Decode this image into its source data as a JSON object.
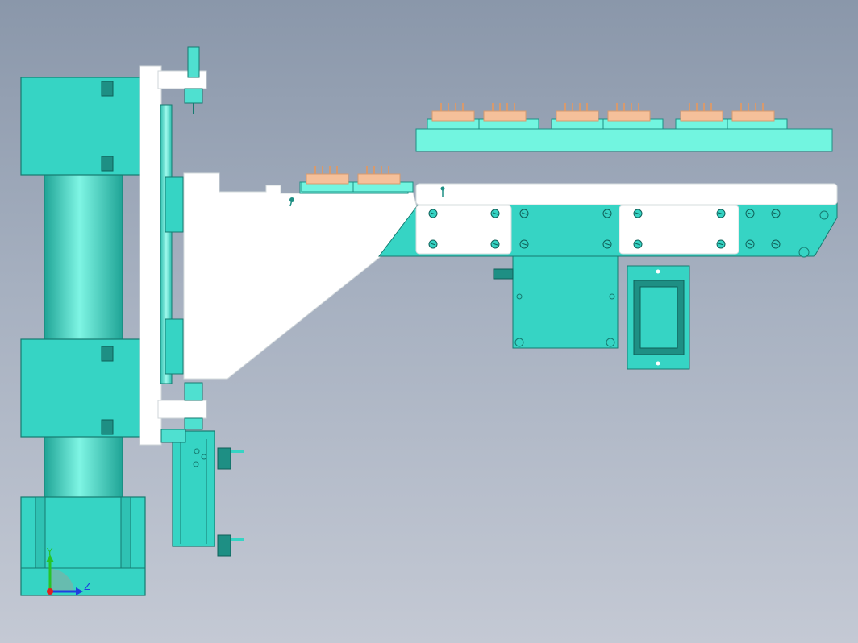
{
  "viewport": {
    "background_top": "#8a97aa",
    "background_bottom": "#c4c9d4"
  },
  "colors": {
    "teal_face": "#36d4c4",
    "teal_light": "#7ff5e4",
    "teal_dark": "#1e8f84",
    "teal_edge": "#167a70",
    "white_part": "#ffffff",
    "peach_part": "#f5c09a",
    "outline": "#0f5f58"
  },
  "axis_triad": {
    "y_label": "Y",
    "z_label": "Z",
    "y_color": "#27c427",
    "z_color": "#1f3fe0",
    "x_color": "#e02020"
  },
  "parts": {
    "vertical_column": "guide-column",
    "upper_carriage": "upper-slide-block",
    "lower_carriage": "lower-slide-block",
    "base_block": "column-base",
    "mounting_plate": "white-mounting-plate",
    "bracket": "triangular-bracket",
    "cylinder": "pneumatic-cylinder",
    "upper_conveyor": "upper-product-rail",
    "lower_conveyor": "lower-conveyor-arm",
    "motor_plate": "motor-mount-plate",
    "side_box": "side-junction-box"
  },
  "products": {
    "upper_rail_count": 6,
    "lower_rail_count": 2
  }
}
